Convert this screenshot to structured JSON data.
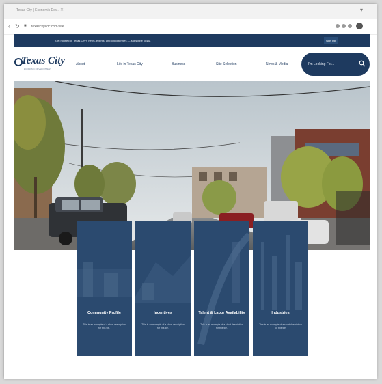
{
  "browser": {
    "tab_title": "Texas City | Economic Dev...",
    "url": "texascityedc.com/site",
    "back_icon": "arrow-left-icon",
    "reload_icon": "reload-icon"
  },
  "banner": {
    "text": "Get notified of Texas City's news, events, and opportunities — subscribe today.",
    "button_label": "Sign Up"
  },
  "header": {
    "logo_text": "Texas City",
    "logo_sub": "ECONOMIC DEVELOPMENT",
    "nav": [
      "About",
      "Life in Texas City",
      "Business",
      "Site Selection",
      "News & Media"
    ],
    "search_placeholder": "I'm Looking For..."
  },
  "cards": [
    {
      "title": "Community Profile",
      "desc": "This is an example of a short description for this tile."
    },
    {
      "title": "Incentives",
      "desc": "This is an example of a short description for this tile."
    },
    {
      "title": "Talent & Labor Availability",
      "desc": "This is an example of a short description for this tile."
    },
    {
      "title": "Industries",
      "desc": "This is an example of a short description for this tile."
    }
  ],
  "colors": {
    "navy": "#1e3a5f",
    "card": "#2b4a6f"
  }
}
